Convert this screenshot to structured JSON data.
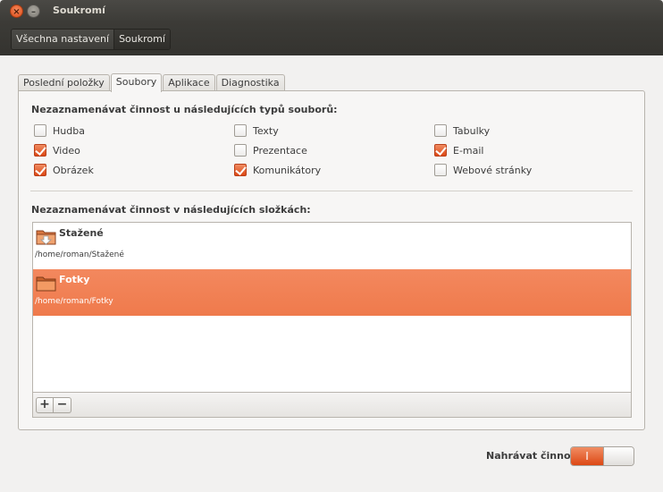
{
  "window": {
    "title": "Soukromí",
    "close_glyph": "×",
    "minimize_glyph": "–"
  },
  "breadcrumb": [
    "Všechna nastavení",
    "Soukromí"
  ],
  "tabs": [
    {
      "label": "Poslední položky",
      "active": false
    },
    {
      "label": "Soubory",
      "active": true
    },
    {
      "label": "Aplikace",
      "active": false
    },
    {
      "label": "Diagnostika",
      "active": false
    }
  ],
  "file_types": {
    "title": "Nezaznamenávat činnost u následujících typů souborů:",
    "items": [
      {
        "label": "Hudba",
        "checked": false
      },
      {
        "label": "Video",
        "checked": true
      },
      {
        "label": "Obrázek",
        "checked": true
      },
      {
        "label": "Texty",
        "checked": false
      },
      {
        "label": "Prezentace",
        "checked": false
      },
      {
        "label": "Komunikátory",
        "checked": true
      },
      {
        "label": "Tabulky",
        "checked": false
      },
      {
        "label": "E-mail",
        "checked": true
      },
      {
        "label": "Webové stránky",
        "checked": false
      }
    ]
  },
  "folders": {
    "title": "Nezaznamenávat činnost v následujících složkách:",
    "items": [
      {
        "name": "Stažené",
        "path": "/home/roman/Stažené",
        "selected": false,
        "icon": "downloads-folder-icon"
      },
      {
        "name": "Fotky",
        "path": "/home/roman/Fotky",
        "selected": true,
        "icon": "folder-icon"
      }
    ],
    "add_label": "+",
    "remove_label": "−"
  },
  "record": {
    "label": "Nahrávat činnost",
    "switch_on_label": "I",
    "on": true
  },
  "colors": {
    "accent": "#dd4814",
    "selection": "#f08050",
    "titlebar": "#3c3b37"
  }
}
